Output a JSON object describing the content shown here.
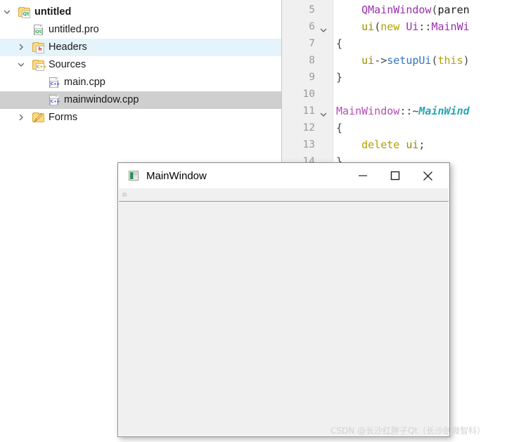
{
  "project_tree": {
    "rows": [
      {
        "label": "untitled",
        "twisty": "expanded",
        "icon": "qt-project-folder-icon",
        "indent": 0,
        "state": "normal",
        "bold": true
      },
      {
        "label": "untitled.pro",
        "twisty": "none",
        "icon": "qt-pro-file-icon",
        "indent": 1,
        "state": "normal",
        "bold": false
      },
      {
        "label": "Headers",
        "twisty": "collapsed",
        "icon": "headers-folder-icon",
        "indent": 1,
        "state": "hovered",
        "bold": false
      },
      {
        "label": "Sources",
        "twisty": "expanded",
        "icon": "sources-folder-icon",
        "indent": 1,
        "state": "normal",
        "bold": false
      },
      {
        "label": "main.cpp",
        "twisty": "none",
        "icon": "cpp-file-icon",
        "indent": 2,
        "state": "normal",
        "bold": false
      },
      {
        "label": "mainwindow.cpp",
        "twisty": "none",
        "icon": "cpp-file-icon",
        "indent": 2,
        "state": "selected",
        "bold": false
      },
      {
        "label": "Forms",
        "twisty": "collapsed",
        "icon": "forms-folder-icon",
        "indent": 1,
        "state": "normal",
        "bold": false
      }
    ],
    "icon_badges": {
      "qt_badge": "Qt",
      "headers_badge": "h",
      "sources_badge": "C++",
      "cpp_badge": "C++"
    },
    "colors": {
      "folder_fill": "#fdd97f",
      "folder_stroke": "#d9ab3c",
      "qt_green": "#2fa84f",
      "headers_red": "#d0202b",
      "sources_orange": "#e08a12",
      "cpp_blue": "#3d3df0",
      "selected_row": "#cfcfcf",
      "hovered_row": "#e5f3fb"
    }
  },
  "code_editor": {
    "lines": [
      {
        "number": "5",
        "fold": "",
        "text": "    QMainWindow(paren"
      },
      {
        "number": "6",
        "fold": "v",
        "text": "    ui(new Ui::MainWi"
      },
      {
        "number": "7",
        "fold": "",
        "text": "{"
      },
      {
        "number": "8",
        "fold": "",
        "text": "    ui->setupUi(this)"
      },
      {
        "number": "9",
        "fold": "",
        "text": "}"
      },
      {
        "number": "10",
        "fold": "",
        "text": ""
      },
      {
        "number": "11",
        "fold": "v",
        "text": "MainWindow::~MainWind"
      },
      {
        "number": "12",
        "fold": "",
        "text": "{"
      },
      {
        "number": "13",
        "fold": "",
        "text": "    delete ui;"
      },
      {
        "number": "14",
        "fold": "",
        "text": "}"
      }
    ],
    "colors": {
      "gutter_bg": "#f0f0f0",
      "line_number": "#9a9a9a",
      "type": "#9b2fae",
      "keyword": "#b1a000",
      "function": "#2f74c0",
      "destructor": "#29a6b3",
      "plain": "#1a1a1a"
    }
  },
  "mainwindow_dialog": {
    "title": "MainWindow",
    "app_icon": "qt-window-icon",
    "buttons": [
      {
        "name": "minimize",
        "glyph": "─"
      },
      {
        "name": "maximize",
        "glyph": "□"
      },
      {
        "name": "close",
        "glyph": "✕"
      }
    ],
    "client_bg": "#f0f0f0"
  },
  "watermark": {
    "text": "CSDN @长沙红胖子Qt（长沙创微智科）"
  }
}
